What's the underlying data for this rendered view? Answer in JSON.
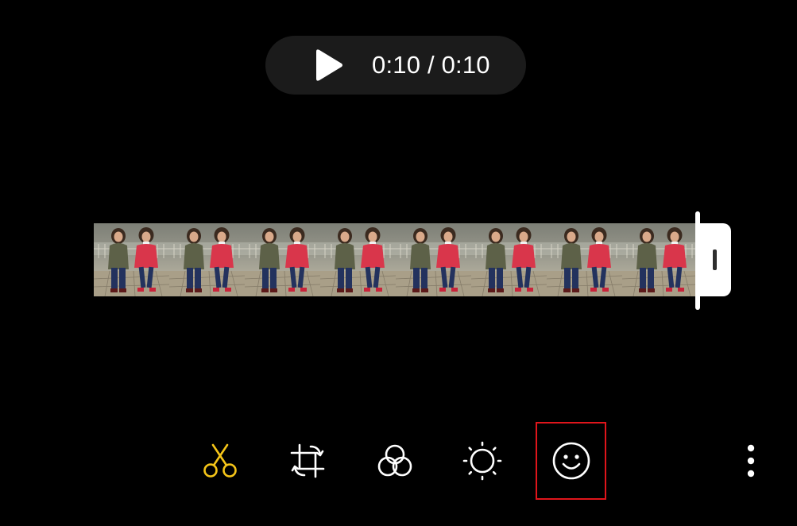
{
  "player": {
    "play_icon": "play-icon",
    "time_display": "0:10 / 0:10"
  },
  "timeline": {
    "frame_count": 8,
    "frame_content": "thumbnail-two-children-walking",
    "handle_icon": "trim-handle-grip",
    "playhead_position": 1.0
  },
  "toolbar": {
    "items": [
      {
        "name": "trim",
        "icon": "scissors-icon",
        "active": true
      },
      {
        "name": "transform",
        "icon": "crop-rotate-icon",
        "active": false
      },
      {
        "name": "filter",
        "icon": "filter-circles-icon",
        "active": false
      },
      {
        "name": "adjust",
        "icon": "brightness-icon",
        "active": false
      },
      {
        "name": "sticker",
        "icon": "smiley-icon",
        "active": false,
        "highlighted": true
      }
    ],
    "more_icon": "more-vertical-icon"
  },
  "colors": {
    "background": "#000000",
    "pill_background": "#1b1b1b",
    "active_tool": "#f5c518",
    "icon": "#ffffff",
    "highlight_border": "#e0151b"
  }
}
